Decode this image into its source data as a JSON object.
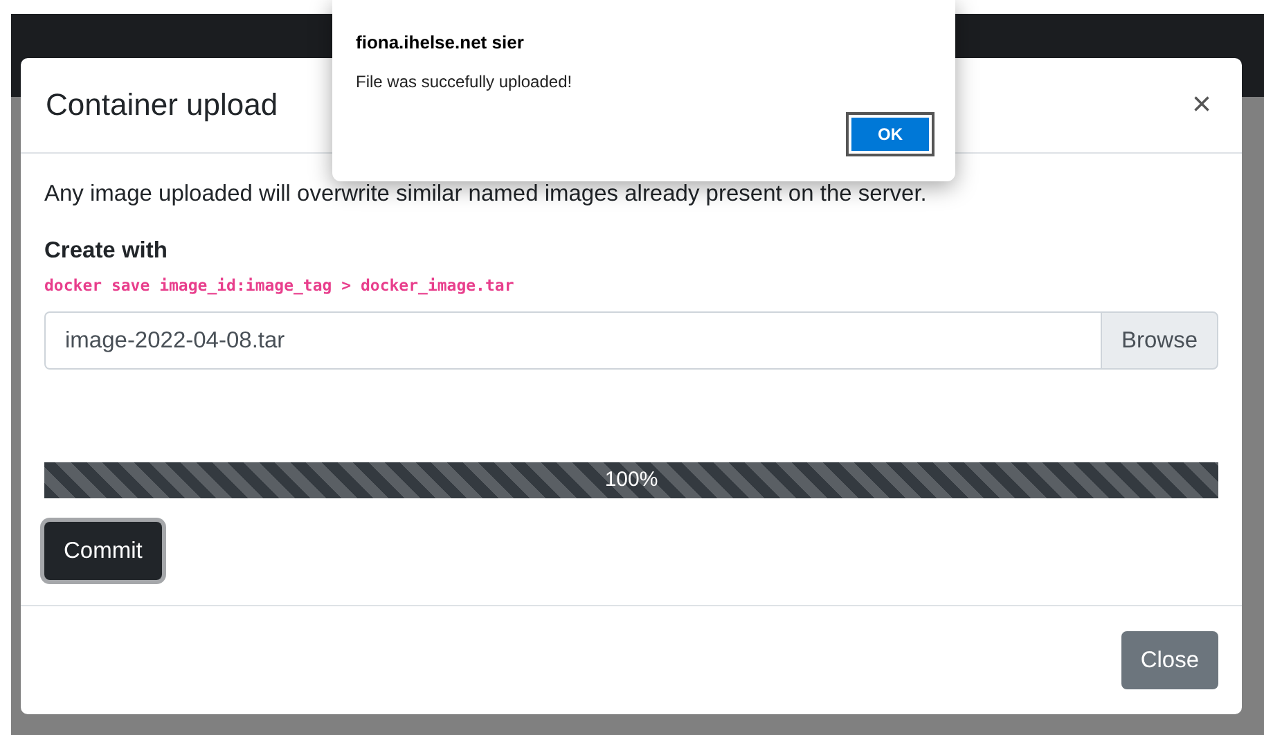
{
  "modal": {
    "title": "Container upload",
    "close_symbol": "×",
    "notice": "Any image uploaded will overwrite similar named images already present on the server.",
    "create_heading": "Create with",
    "command": "docker save image_id:image_tag > docker_image.tar",
    "file_field": {
      "value": "image-2022-04-08.tar",
      "button": "Browse"
    },
    "progress": {
      "level": 1,
      "reading": "100%"
    },
    "commit_button": "Commit",
    "close_button": "Close"
  },
  "alert": {
    "title": "fiona.ihelse.net sier",
    "message": "File was succefully uploaded!",
    "ok_button": "OK"
  }
}
